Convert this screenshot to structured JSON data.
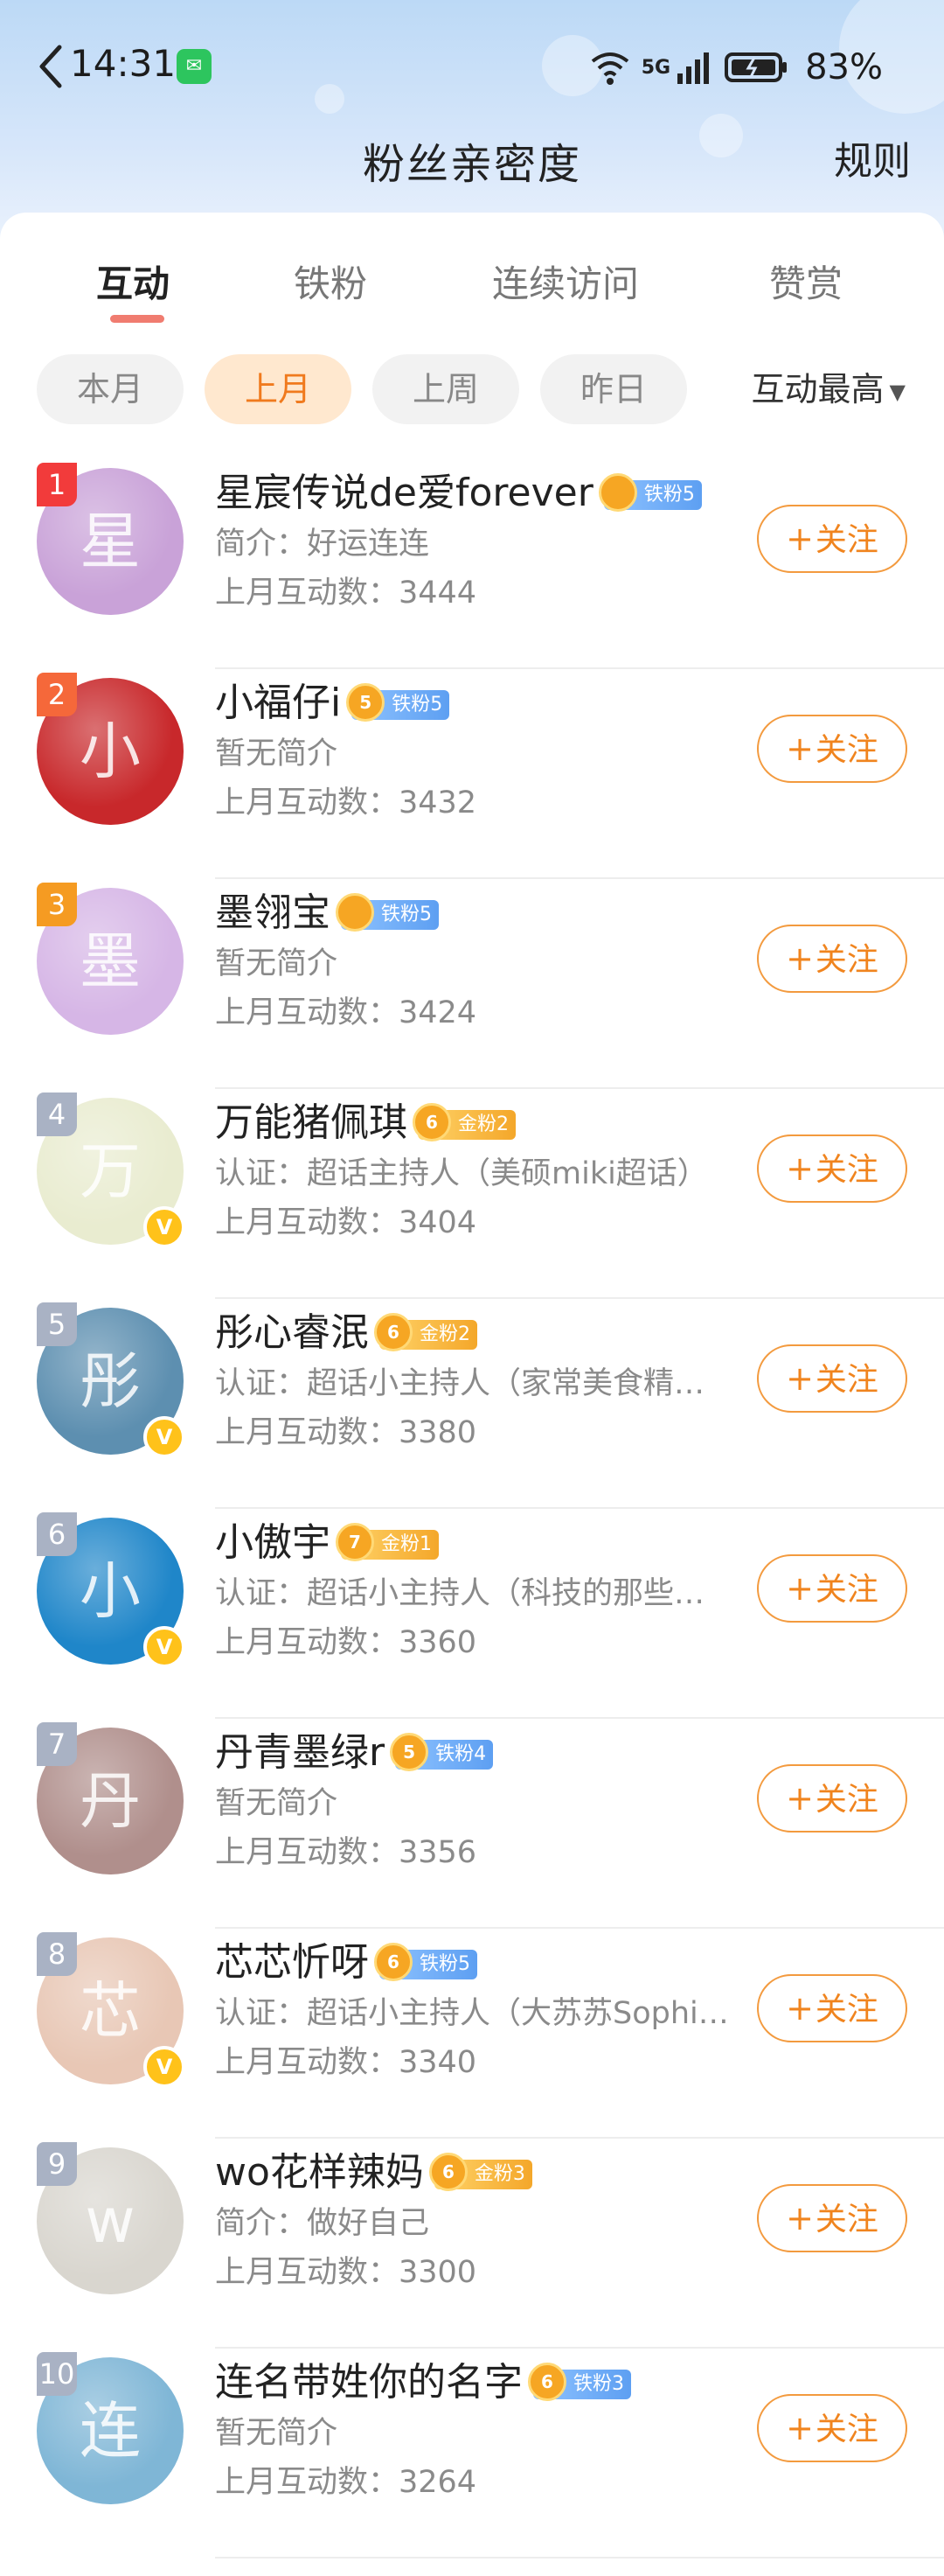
{
  "status_bar": {
    "time": "14:31",
    "network_label": "5G",
    "battery_percent": "83%",
    "icons": [
      "back-chevron-icon",
      "wechat-icon",
      "wifi-icon",
      "signal-icon",
      "battery-icon"
    ]
  },
  "header": {
    "title": "粉丝亲密度",
    "rules_label": "规则"
  },
  "tabs": [
    {
      "label": "互动",
      "active": true
    },
    {
      "label": "铁粉",
      "active": false
    },
    {
      "label": "连续访问",
      "active": false
    },
    {
      "label": "赞赏",
      "active": false
    }
  ],
  "filters": [
    {
      "label": "本月",
      "active": false
    },
    {
      "label": "上月",
      "active": true
    },
    {
      "label": "上周",
      "active": false
    },
    {
      "label": "昨日",
      "active": false
    }
  ],
  "sort": {
    "label": "互动最高"
  },
  "follow_label": "关注",
  "colors": {
    "accent": "#f0841e",
    "tab_underline": "#f07c70",
    "iron_badge": "#5d9ff2",
    "gold_badge": "#f4a72a",
    "verified": "#ffc21a"
  },
  "fans": [
    {
      "rank": "1",
      "name": "星宸传说de爱forever",
      "badge": "铁粉5",
      "badge_type": "iron",
      "crown_level": "",
      "subtitle": "简介：好运连连",
      "interactions": "上月互动数：3444",
      "verified": false,
      "avatar_color": "#c9a2d8"
    },
    {
      "rank": "2",
      "name": "小福仔i",
      "badge": "铁粉5",
      "badge_type": "iron",
      "crown_level": "5",
      "subtitle": "暂无简介",
      "interactions": "上月互动数：3432",
      "verified": false,
      "avatar_color": "#c8282b"
    },
    {
      "rank": "3",
      "name": "墨翎宝",
      "badge": "铁粉5",
      "badge_type": "iron",
      "crown_level": "",
      "subtitle": "暂无简介",
      "interactions": "上月互动数：3424",
      "verified": false,
      "avatar_color": "#d6b6e6"
    },
    {
      "rank": "4",
      "name": "万能猪佩琪",
      "badge": "金粉2",
      "badge_type": "gold",
      "crown_level": "6",
      "subtitle": "认证：超话主持人（美硕miki超话）",
      "interactions": "上月互动数：3404",
      "verified": true,
      "avatar_color": "#e9ecd0"
    },
    {
      "rank": "5",
      "name": "彤心睿泯",
      "badge": "金粉2",
      "badge_type": "gold",
      "crown_level": "6",
      "subtitle": "认证：超话小主持人（家常美食精选超话）",
      "interactions": "上月互动数：3380",
      "verified": true,
      "avatar_color": "#5d8fb0"
    },
    {
      "rank": "6",
      "name": "小傲宇",
      "badge": "金粉1",
      "badge_type": "gold",
      "crown_level": "7",
      "subtitle": "认证：超话小主持人（科技的那些事超话）",
      "interactions": "上月互动数：3360",
      "verified": true,
      "avatar_color": "#1f86c9"
    },
    {
      "rank": "7",
      "name": "丹青墨绿r",
      "badge": "铁粉4",
      "badge_type": "iron",
      "crown_level": "5",
      "subtitle": "暂无简介",
      "interactions": "上月互动数：3356",
      "verified": false,
      "avatar_color": "#b08f8c"
    },
    {
      "rank": "8",
      "name": "芯芯忻呀",
      "badge": "铁粉5",
      "badge_type": "iron",
      "crown_level": "6",
      "subtitle": "认证：超话小主持人（大苏苏Sophia超话）",
      "interactions": "上月互动数：3340",
      "verified": true,
      "avatar_color": "#e8c7b5"
    },
    {
      "rank": "9",
      "name": "wo花样辣妈",
      "badge": "金粉3",
      "badge_type": "gold",
      "crown_level": "6",
      "subtitle": "简介：做好自己",
      "interactions": "上月互动数：3300",
      "verified": false,
      "avatar_color": "#d9d6cf"
    },
    {
      "rank": "10",
      "name": "连名带姓你的名字",
      "badge": "铁粉3",
      "badge_type": "iron",
      "crown_level": "6",
      "subtitle": "暂无简介",
      "interactions": "上月互动数：3264",
      "verified": false,
      "avatar_color": "#7fb6d6"
    }
  ]
}
